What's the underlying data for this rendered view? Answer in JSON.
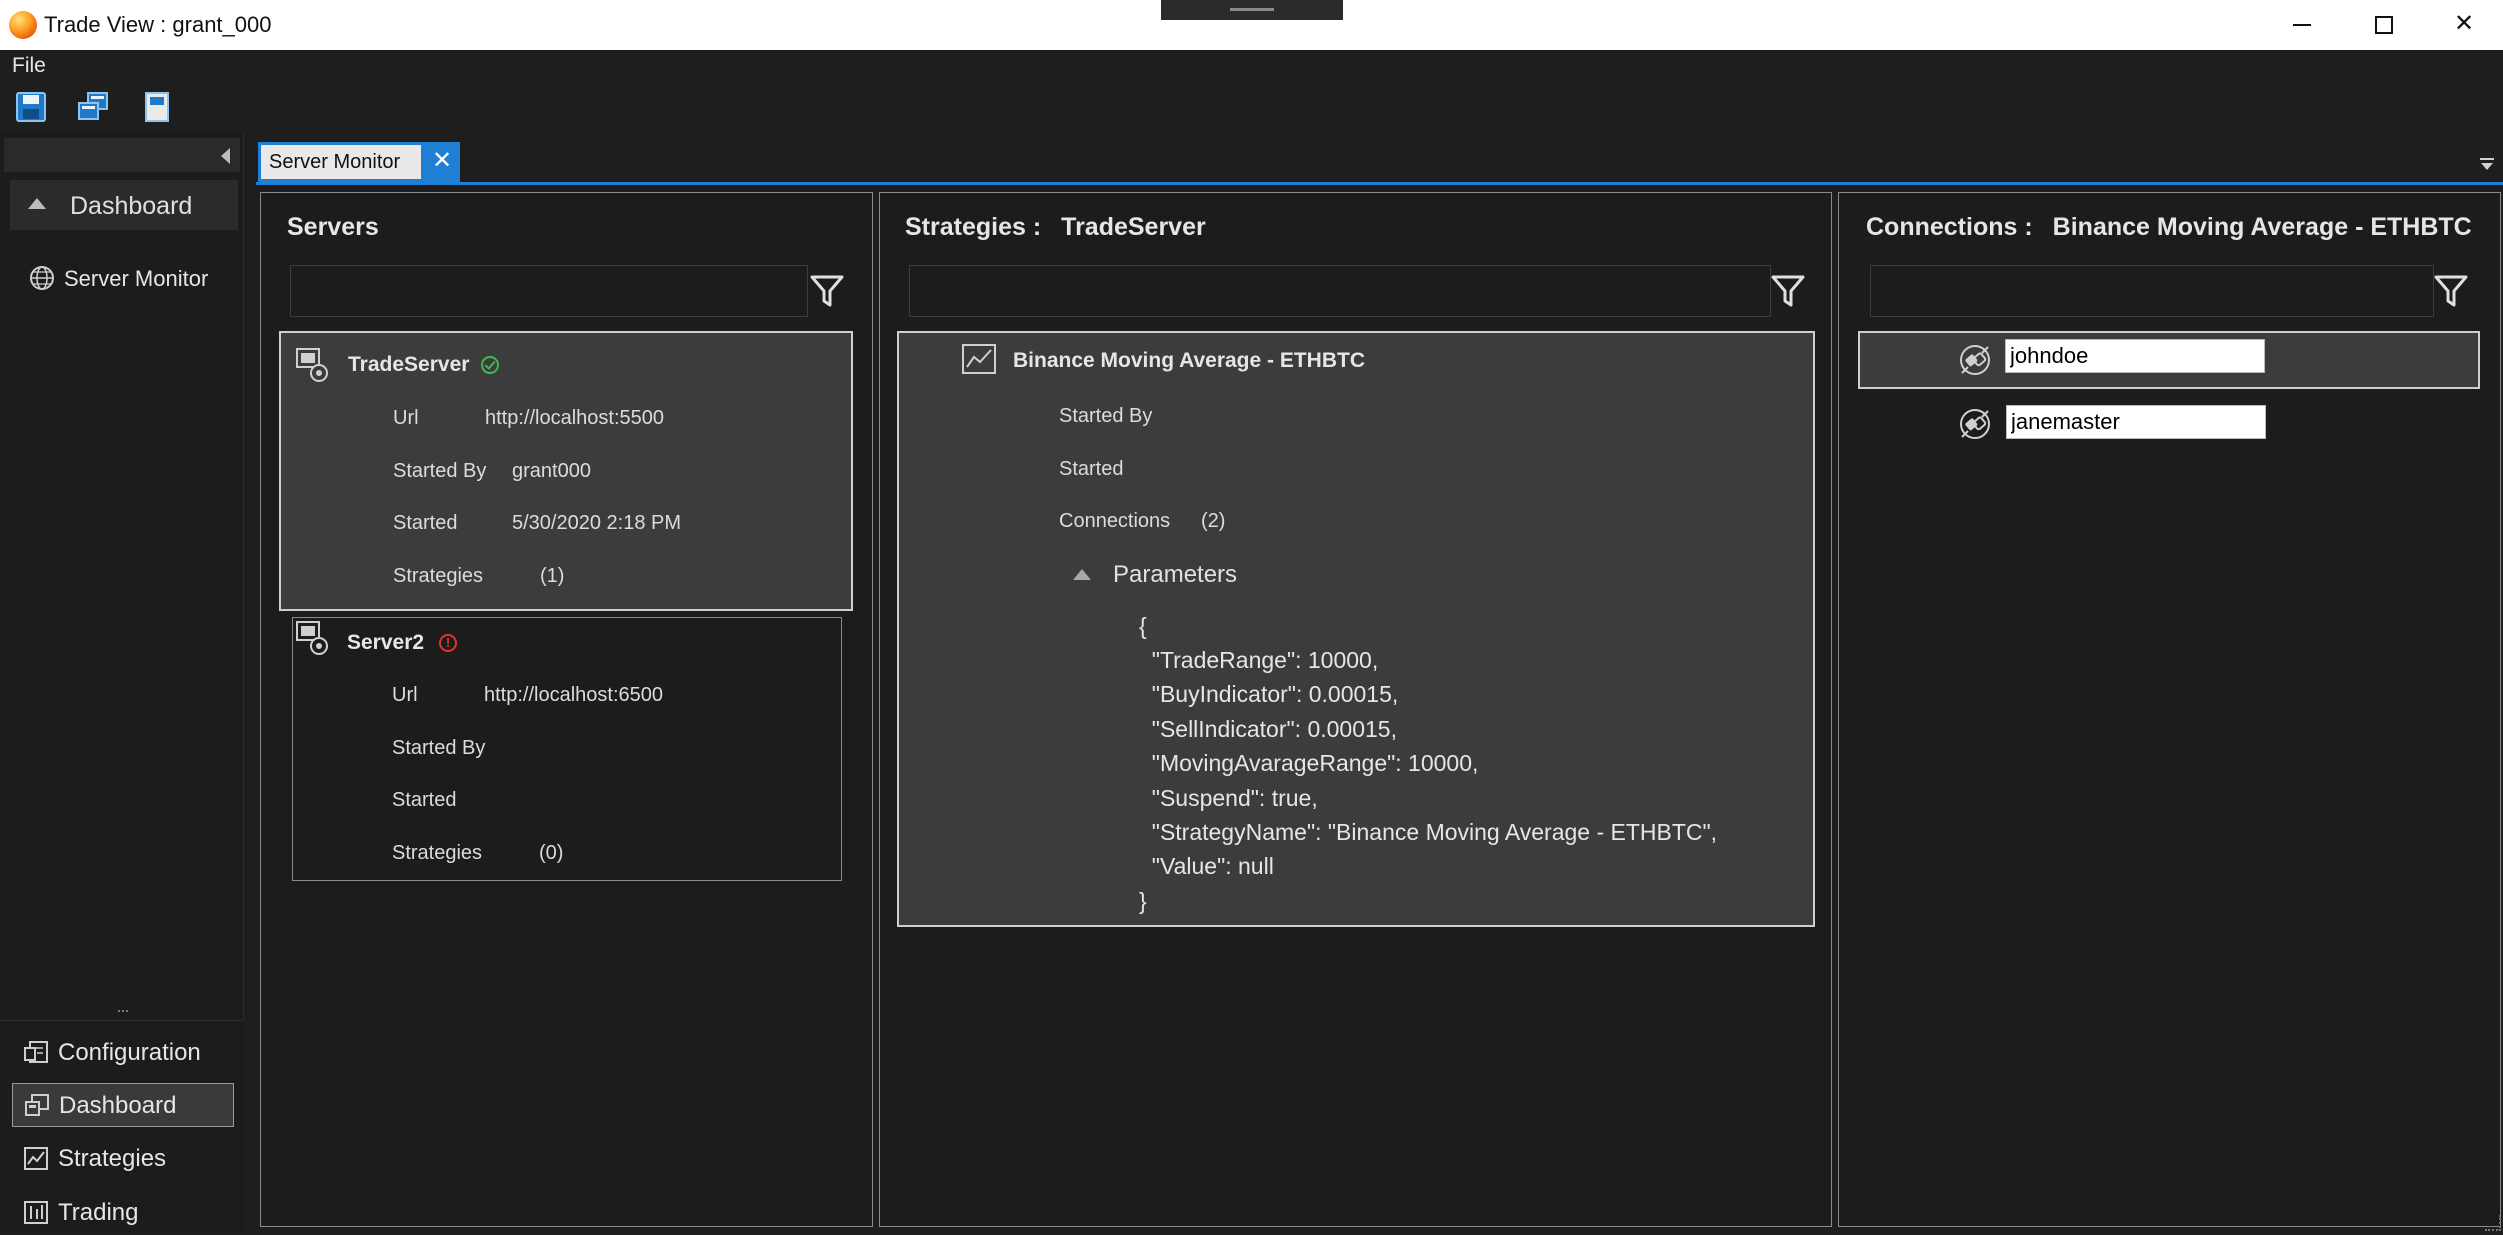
{
  "window": {
    "title": "Trade View : grant_000",
    "minimize_icon": "minimize-icon",
    "maximize_icon": "maximize-icon",
    "close_glyph": "✕"
  },
  "menu": {
    "file": "File"
  },
  "toolbar": {
    "icons": [
      "save-icon",
      "windows-icon",
      "page-icon"
    ]
  },
  "leftnav": {
    "section_label": "Dashboard",
    "items": [
      {
        "label": "Server Monitor",
        "icon": "globe-icon"
      }
    ],
    "bottom": [
      {
        "label": "Configuration",
        "icon": "configuration-icon",
        "active": false
      },
      {
        "label": "Dashboard",
        "icon": "dashboard-icon",
        "active": true
      },
      {
        "label": "Strategies",
        "icon": "chart-icon",
        "active": false
      },
      {
        "label": "Trading",
        "icon": "trading-icon",
        "active": false
      }
    ]
  },
  "tab": {
    "label": "Server Monitor",
    "close": "✕"
  },
  "servers_panel": {
    "title": "Servers",
    "filter_value": "",
    "servers": [
      {
        "name": "TradeServer",
        "status": "ok",
        "url_key": "Url",
        "url": "http://localhost:5500",
        "started_by_key": "Started By",
        "started_by": "grant000",
        "started_key": "Started",
        "started": "5/30/2020 2:18 PM",
        "strategies_key": "Strategies",
        "strategies": "(1)"
      },
      {
        "name": "Server2",
        "status": "error",
        "url_key": "Url",
        "url": "http://localhost:6500",
        "started_by_key": "Started By",
        "started_by": "",
        "started_key": "Started",
        "started": "",
        "strategies_key": "Strategies",
        "strategies": "(0)"
      }
    ]
  },
  "strategies_panel": {
    "title": "Strategies :",
    "subtitle": "TradeServer",
    "filter_value": "",
    "strategy": {
      "name": "Binance Moving Average - ETHBTC",
      "started_by_key": "Started By",
      "started_key": "Started",
      "connections_key": "Connections",
      "connections_value": "(2)",
      "parameters_label": "Parameters",
      "json_lines": [
        "{",
        "  \"TradeRange\": 10000,",
        "  \"BuyIndicator\": 0.00015,",
        "  \"SellIndicator\": 0.00015,",
        "  \"MovingAvarageRange\": 10000,",
        "  \"Suspend\": true,",
        "  \"StrategyName\": \"Binance Moving Average - ETHBTC\",",
        "  \"Value\": null",
        "}"
      ]
    }
  },
  "connections_panel": {
    "title": "Connections :",
    "subtitle": "Binance Moving Average - ETHBTC",
    "filter_value": "",
    "connections": [
      {
        "name": "johndoe",
        "selected": true
      },
      {
        "name": "janemaster",
        "selected": false
      }
    ]
  },
  "colors": {
    "accent": "#1e7fd4",
    "background": "#1e1e1e",
    "selected_card": "#3c3c3c",
    "status_ok": "#3fb950",
    "status_error": "#e5332a"
  }
}
